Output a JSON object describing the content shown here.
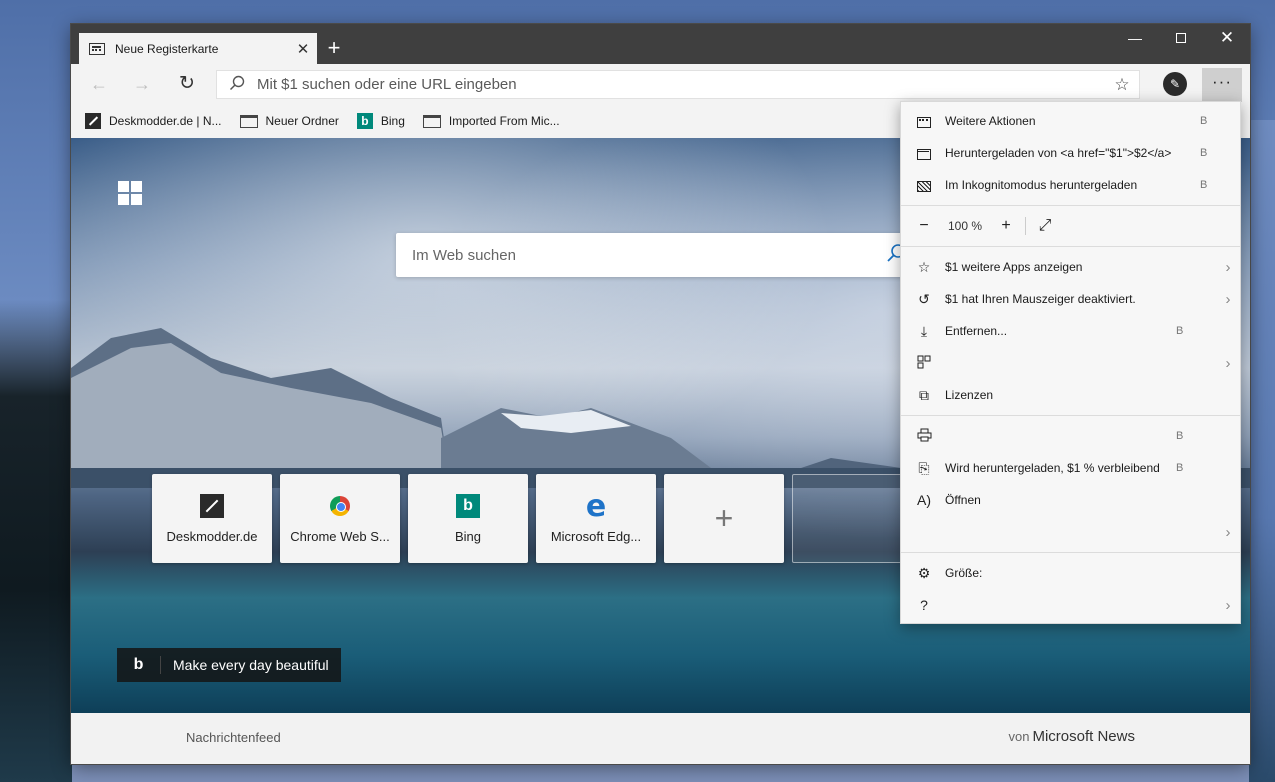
{
  "tab": {
    "title": "Neue Registerkarte"
  },
  "address": {
    "placeholder": "Mit $1 suchen oder eine URL eingeben"
  },
  "favorites": [
    {
      "label": "Deskmodder.de | N..."
    },
    {
      "label": "Neuer Ordner"
    },
    {
      "label": "Bing"
    },
    {
      "label": "Imported From Mic..."
    }
  ],
  "newtab": {
    "search_placeholder": "Im Web suchen",
    "tiles": [
      {
        "label": "Deskmodder.de"
      },
      {
        "label": "Chrome Web S..."
      },
      {
        "label": "Bing"
      },
      {
        "label": "Microsoft Edg..."
      }
    ],
    "add_tile": "+",
    "bing_tagline": "Make every day beautiful"
  },
  "footer": {
    "newsfeed": "Nachrichtenfeed",
    "von": "von",
    "source": "Microsoft News"
  },
  "menu": {
    "items_top": [
      {
        "label": "Weitere Aktionen",
        "key": "B",
        "icon": "new-tab-icon"
      },
      {
        "label": "Heruntergeladen von <a href=\"$1\">$2</a>",
        "key": "B",
        "icon": "new-window-icon"
      },
      {
        "label": "Im Inkognitomodus heruntergeladen",
        "key": "B",
        "icon": "inprivate-window-icon"
      }
    ],
    "zoom": {
      "minus": "−",
      "value": "100 %",
      "plus": "+",
      "fullscreen": "⤢"
    },
    "items_mid": [
      {
        "label": "$1 weitere Apps anzeigen",
        "key": "",
        "arrow": "›",
        "icon": "star-icon"
      },
      {
        "label": "$1 hat Ihren Mauszeiger deaktiviert.",
        "key": "",
        "arrow": "›",
        "icon": "history-icon"
      },
      {
        "label": "Entfernen...",
        "key": "B",
        "arrow": "",
        "icon": "download-icon"
      },
      {
        "label": "",
        "key": "",
        "arrow": "›",
        "icon": "apps-icon"
      },
      {
        "label": "Lizenzen",
        "key": "",
        "arrow": "",
        "icon": "extensions-icon"
      }
    ],
    "items_low": [
      {
        "label": "",
        "key": "B",
        "arrow": "",
        "icon": "print-icon"
      },
      {
        "label": "Wird heruntergeladen, $1 % verbleibend",
        "key": "B",
        "arrow": "",
        "icon": "share-icon"
      },
      {
        "label": "Öffnen",
        "key": "",
        "arrow": "",
        "icon": "read-aloud-icon"
      },
      {
        "label": "",
        "key": "",
        "arrow": "›",
        "icon": "more-tools-icon"
      }
    ],
    "items_bottom": [
      {
        "label": "Größe:",
        "key": "",
        "arrow": "",
        "icon": "settings-icon"
      },
      {
        "label": "",
        "key": "",
        "arrow": "›",
        "icon": "help-icon"
      }
    ]
  }
}
